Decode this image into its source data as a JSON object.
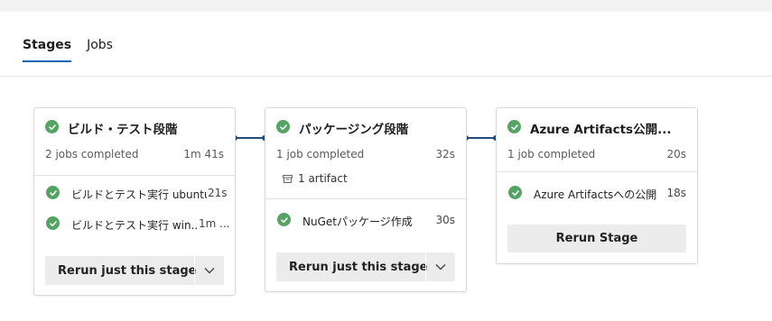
{
  "tabs": {
    "stages": "Stages",
    "jobs": "Jobs"
  },
  "stages": [
    {
      "title": "ビルド・テスト段階",
      "summary": "2 jobs completed",
      "duration": "1m 41s",
      "jobs": [
        {
          "name": "ビルドとテスト実行 ubuntu",
          "time": "21s"
        },
        {
          "name": "ビルドとテスト実行 win...",
          "time": "1m ..."
        }
      ],
      "button": "Rerun just this stage"
    },
    {
      "title": "パッケージング段階",
      "summary": "1 job completed",
      "duration": "32s",
      "artifact": "1 artifact",
      "jobs": [
        {
          "name": "NuGetパッケージ作成",
          "time": "30s"
        }
      ],
      "button": "Rerun just this stage"
    },
    {
      "title": "Azure Artifacts公開...",
      "summary": "1 job completed",
      "duration": "20s",
      "jobs": [
        {
          "name": "Azure Artifactsへの公開",
          "time": "18s"
        }
      ],
      "button": "Rerun Stage"
    }
  ],
  "colors": {
    "success": "#55a362",
    "connector": "#1c4d7c",
    "tab_underline": "#0a69b6"
  },
  "icons": [
    "check-icon",
    "chevron-down-icon",
    "artifact-icon"
  ]
}
